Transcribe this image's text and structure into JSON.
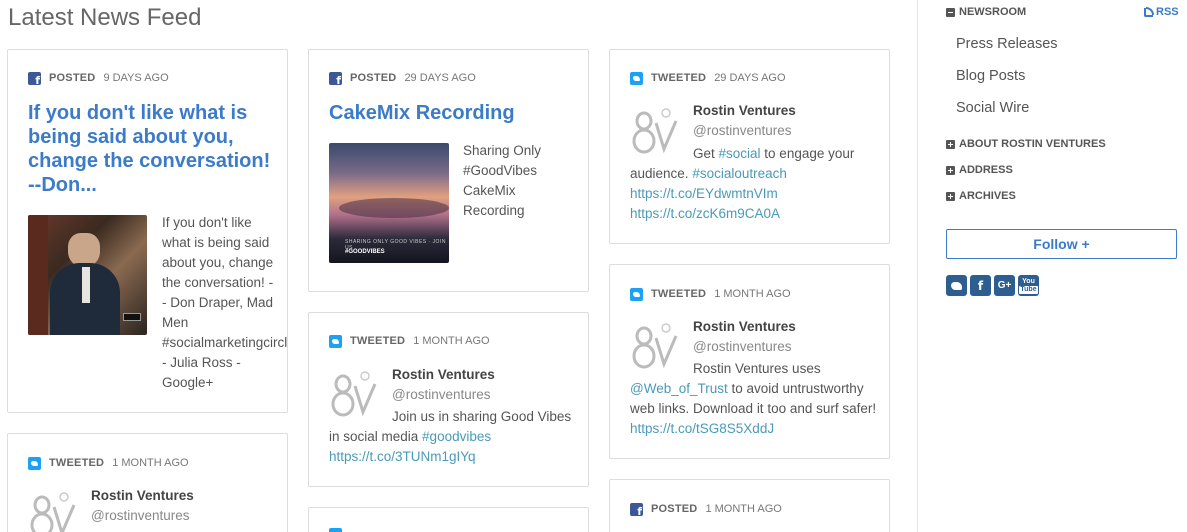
{
  "page_title": "Latest News Feed",
  "cards": {
    "c1": {
      "kind": "POSTED",
      "age": "9 DAYS AGO",
      "icon": "facebook-icon",
      "title": "If you don't like what is being said about you, change the conversation! --Don...",
      "text": "If you don't like what is being said about you, change the conversation! -- Don Draper, Mad Men #socialmarketingcircle - Julia Ross - Google+"
    },
    "c2": {
      "kind": "POSTED",
      "age": "29 DAYS AGO",
      "icon": "facebook-icon",
      "title": "CakeMix Recording",
      "text": "Sharing Only #GoodVibes CakeMix Recording",
      "image_caption": "SHARING ONLY GOOD VIBES · JOIN US",
      "image_tag": "#GOODVIBES"
    },
    "c3": {
      "kind": "TWEETED",
      "age": "29 DAYS AGO",
      "icon": "twitter-icon",
      "author": "Rostin Ventures",
      "handle": "@rostinventures",
      "text_a": "Get ",
      "tag_a": "#social",
      "text_b": " to engage your audience. ",
      "tag_b": "#socialoutreach",
      "link_a": "https://t.co/EYdwmtnVIm",
      "link_b": "https://t.co/zcK6m9CA0A"
    },
    "c4": {
      "kind": "TWEETED",
      "age": "1 MONTH AGO",
      "icon": "twitter-icon",
      "author": "Rostin Ventures",
      "handle": "@rostinventures",
      "text_a": "Join us in sharing Good Vibes in social media ",
      "tag_a": "#goodvibes",
      "link_a": "https://t.co/3TUNm1gIYq"
    },
    "c5": {
      "kind": "TWEETED",
      "age": "1 MONTH AGO",
      "icon": "twitter-icon",
      "author": "Rostin Ventures",
      "handle": "@rostinventures",
      "text_a": "Rostin Ventures uses ",
      "tag_a": "@Web_of_Trust",
      "text_b": " to avoid untrustworthy web links. Download it too and surf safer! ",
      "link_a": "https://t.co/tSG8S5XddJ"
    },
    "c6": {
      "kind": "TWEETED",
      "age": "1 MONTH AGO",
      "icon": "twitter-icon",
      "author": "Rostin Ventures",
      "handle": "@rostinventures"
    },
    "c7": {
      "kind": "POSTED",
      "age": "1 MONTH AGO",
      "icon": "facebook-icon"
    }
  },
  "sidebar": {
    "newsroom": "NEWSROOM",
    "rss": "RSS",
    "links": [
      "Press Releases",
      "Blog Posts",
      "Social Wire"
    ],
    "about": "ABOUT ROSTIN VENTURES",
    "address": "ADDRESS",
    "archives": "ARCHIVES",
    "follow": "Follow +",
    "social": [
      "twitter-icon",
      "facebook-icon",
      "google-plus-icon",
      "youtube-icon"
    ]
  }
}
